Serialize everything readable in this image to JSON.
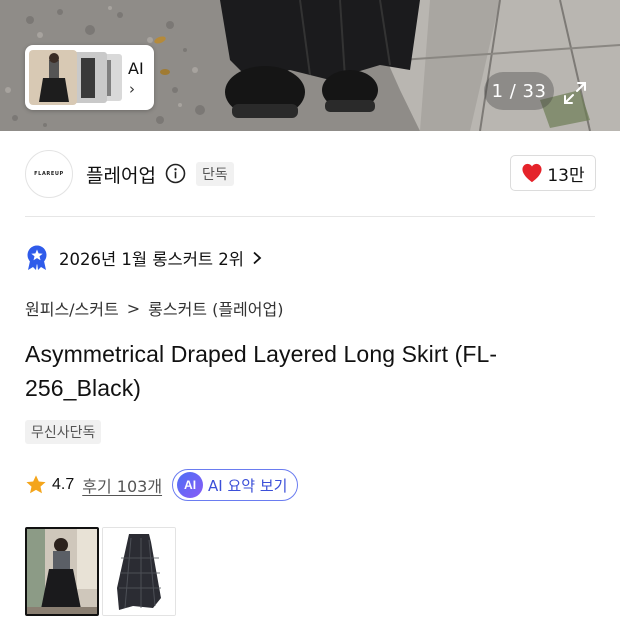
{
  "hero": {
    "ai_label": "AI",
    "ai_chevron": "›",
    "page_counter": "1 / 33",
    "expand_icon": "expand-icon"
  },
  "brand": {
    "logo_text": "FLAREUP",
    "name": "플레어업",
    "badge": "단독",
    "like_count": "13만",
    "heart_color": "#e5232a"
  },
  "ranking": {
    "text": "2026년 1월 롱스커트 2위",
    "chevron": "›",
    "badge_color": "#2f5bea"
  },
  "breadcrumb": {
    "items": [
      "원피스/스커트",
      "롱스커트 (플레어업)"
    ],
    "separator": ">"
  },
  "product": {
    "title": "Asymmetrical Draped Layered Long Skirt (FL-256_Black)",
    "exclusive_tag": "무신사단독"
  },
  "rating": {
    "value": "4.7",
    "review_label": "후기 103개",
    "ai_badge": "AI",
    "ai_summary_label": "AI 요약 보기",
    "star_color": "#f4a51c"
  },
  "thumbnails": {
    "selected_index": 0,
    "count_shown": 2
  }
}
